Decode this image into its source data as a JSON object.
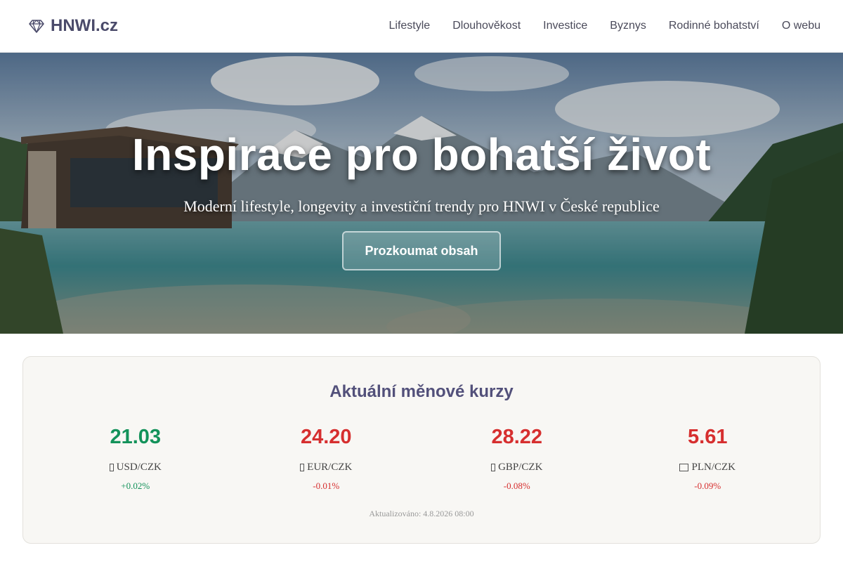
{
  "header": {
    "logo_text": "HNWI.cz",
    "nav": [
      "Lifestyle",
      "Dlouhověkost",
      "Investice",
      "Byznys",
      "Rodinné bohatství",
      "O webu"
    ]
  },
  "hero": {
    "title": "Inspirace pro bohatší život",
    "subtitle": "Moderní lifestyle, longevity a investiční trendy pro HNWI v České republice",
    "button_label": "Prozkoumat obsah"
  },
  "rates": {
    "title": "Aktuální měnové kurzy",
    "items": [
      {
        "value": "21.03",
        "pair": "USD/CZK",
        "change": "+0.02%",
        "direction": "up"
      },
      {
        "value": "24.20",
        "pair": "EUR/CZK",
        "change": "-0.01%",
        "direction": "down"
      },
      {
        "value": "28.22",
        "pair": "GBP/CZK",
        "change": "-0.08%",
        "direction": "down"
      },
      {
        "value": "5.61",
        "pair": "PLN/CZK",
        "change": "-0.09%",
        "direction": "down"
      }
    ],
    "updated": "Aktualizováno: 4.8.2026 08:00"
  },
  "colors": {
    "up": "#13925a",
    "down": "#d62f2f",
    "brand": "#4a4a6a"
  }
}
